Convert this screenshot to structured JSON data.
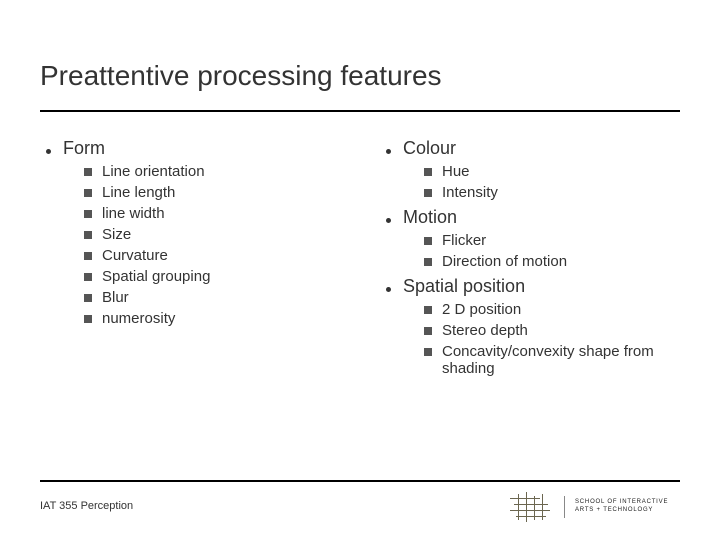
{
  "title": "Preattentive processing features",
  "left": {
    "groups": [
      {
        "label": "Form",
        "items": [
          "Line orientation",
          "Line length",
          "line width",
          "Size",
          "Curvature",
          "Spatial grouping",
          "Blur",
          "numerosity"
        ]
      }
    ]
  },
  "right": {
    "groups": [
      {
        "label": "Colour",
        "items": [
          "Hue",
          "Intensity"
        ]
      },
      {
        "label": "Motion",
        "items": [
          "Flicker",
          "Direction of motion"
        ]
      },
      {
        "label": "Spatial position",
        "items": [
          "2 D position",
          "Stereo depth",
          "Concavity/convexity shape from shading"
        ]
      }
    ]
  },
  "footer": "IAT 355 Perception",
  "logo": {
    "line1": "SCHOOL OF INTERACTIVE",
    "line2": "ARTS + TECHNOLOGY"
  }
}
